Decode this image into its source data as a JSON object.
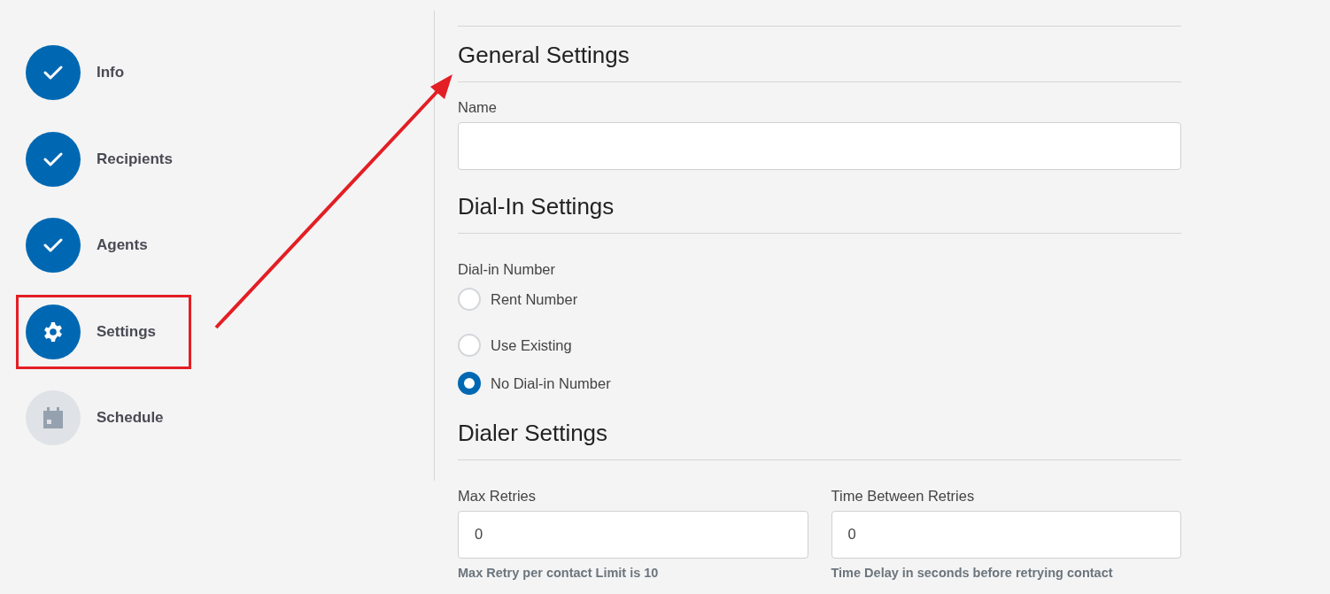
{
  "steps": [
    {
      "label": "Info",
      "kind": "done",
      "highlighted": false
    },
    {
      "label": "Recipients",
      "kind": "done",
      "highlighted": false
    },
    {
      "label": "Agents",
      "kind": "done",
      "highlighted": false
    },
    {
      "label": "Settings",
      "kind": "current",
      "highlighted": true
    },
    {
      "label": "Schedule",
      "kind": "pending",
      "highlighted": false
    }
  ],
  "annotation_arrow": true,
  "general": {
    "heading": "General Settings",
    "name_label": "Name"
  },
  "dial_in": {
    "heading": "Dial-In Settings",
    "group_label": "Dial-in Number",
    "options": [
      {
        "label": "Rent Number",
        "selected": false
      },
      {
        "label": "Use Existing",
        "selected": false
      },
      {
        "label": "No Dial-in Number",
        "selected": true
      }
    ]
  },
  "dialer": {
    "heading": "Dialer Settings",
    "fields": [
      {
        "label": "Max Retries",
        "value": "0",
        "help": "Max Retry per contact Limit is 10"
      },
      {
        "label": "Time Between Retries",
        "value": "0",
        "help": "Time Delay in seconds before retrying contact"
      }
    ]
  }
}
